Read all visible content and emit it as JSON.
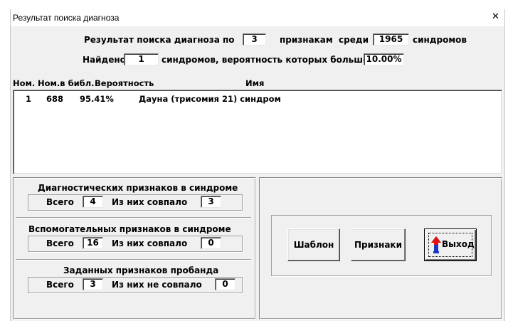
{
  "window": {
    "title": "Результат поиска диагноза",
    "close_glyph": "✕"
  },
  "summary": {
    "line1_prefix": "Результат поиска диагноза по",
    "features_count": "3",
    "line1_mid": "признакам  среди",
    "syndromes_total": "1965",
    "line1_suffix": "синдромов",
    "line2_prefix": "Найдено",
    "found_count": "1",
    "line2_mid": "синдромов, вероятность которых больше",
    "threshold": "10.00%"
  },
  "table": {
    "columns": [
      "Ном.",
      "Ном.в библ.",
      "Вероятность",
      "Имя"
    ],
    "rows": [
      {
        "num": "1",
        "lib_num": "688",
        "probability": "95.41%",
        "name": "Дауна (трисомия 21) синдром"
      }
    ]
  },
  "diagnostic": {
    "title": "Диагностических признаков в синдроме",
    "total_label": "Всего",
    "total": "4",
    "matched_label": "Из них совпало",
    "matched": "3"
  },
  "auxiliary": {
    "title": "Вспомогательных признаков в синдроме",
    "total_label": "Всего",
    "total": "16",
    "matched_label": "Из них совпало",
    "matched": "0"
  },
  "proband": {
    "title": "Заданных признаков пробанда",
    "total_label": "Всего",
    "total": "3",
    "unmatched_label": "Из них не совпало",
    "unmatched": "0"
  },
  "buttons": {
    "template": "Шаблон",
    "features": "Признаки",
    "exit": "Выход"
  },
  "icons": {
    "close": "close-icon",
    "exit": "up-arrow-icon"
  },
  "colors": {
    "window_bg": "#f0f0f0",
    "exit_arrow_red": "#e01010",
    "exit_arrow_blue": "#1838c8"
  }
}
